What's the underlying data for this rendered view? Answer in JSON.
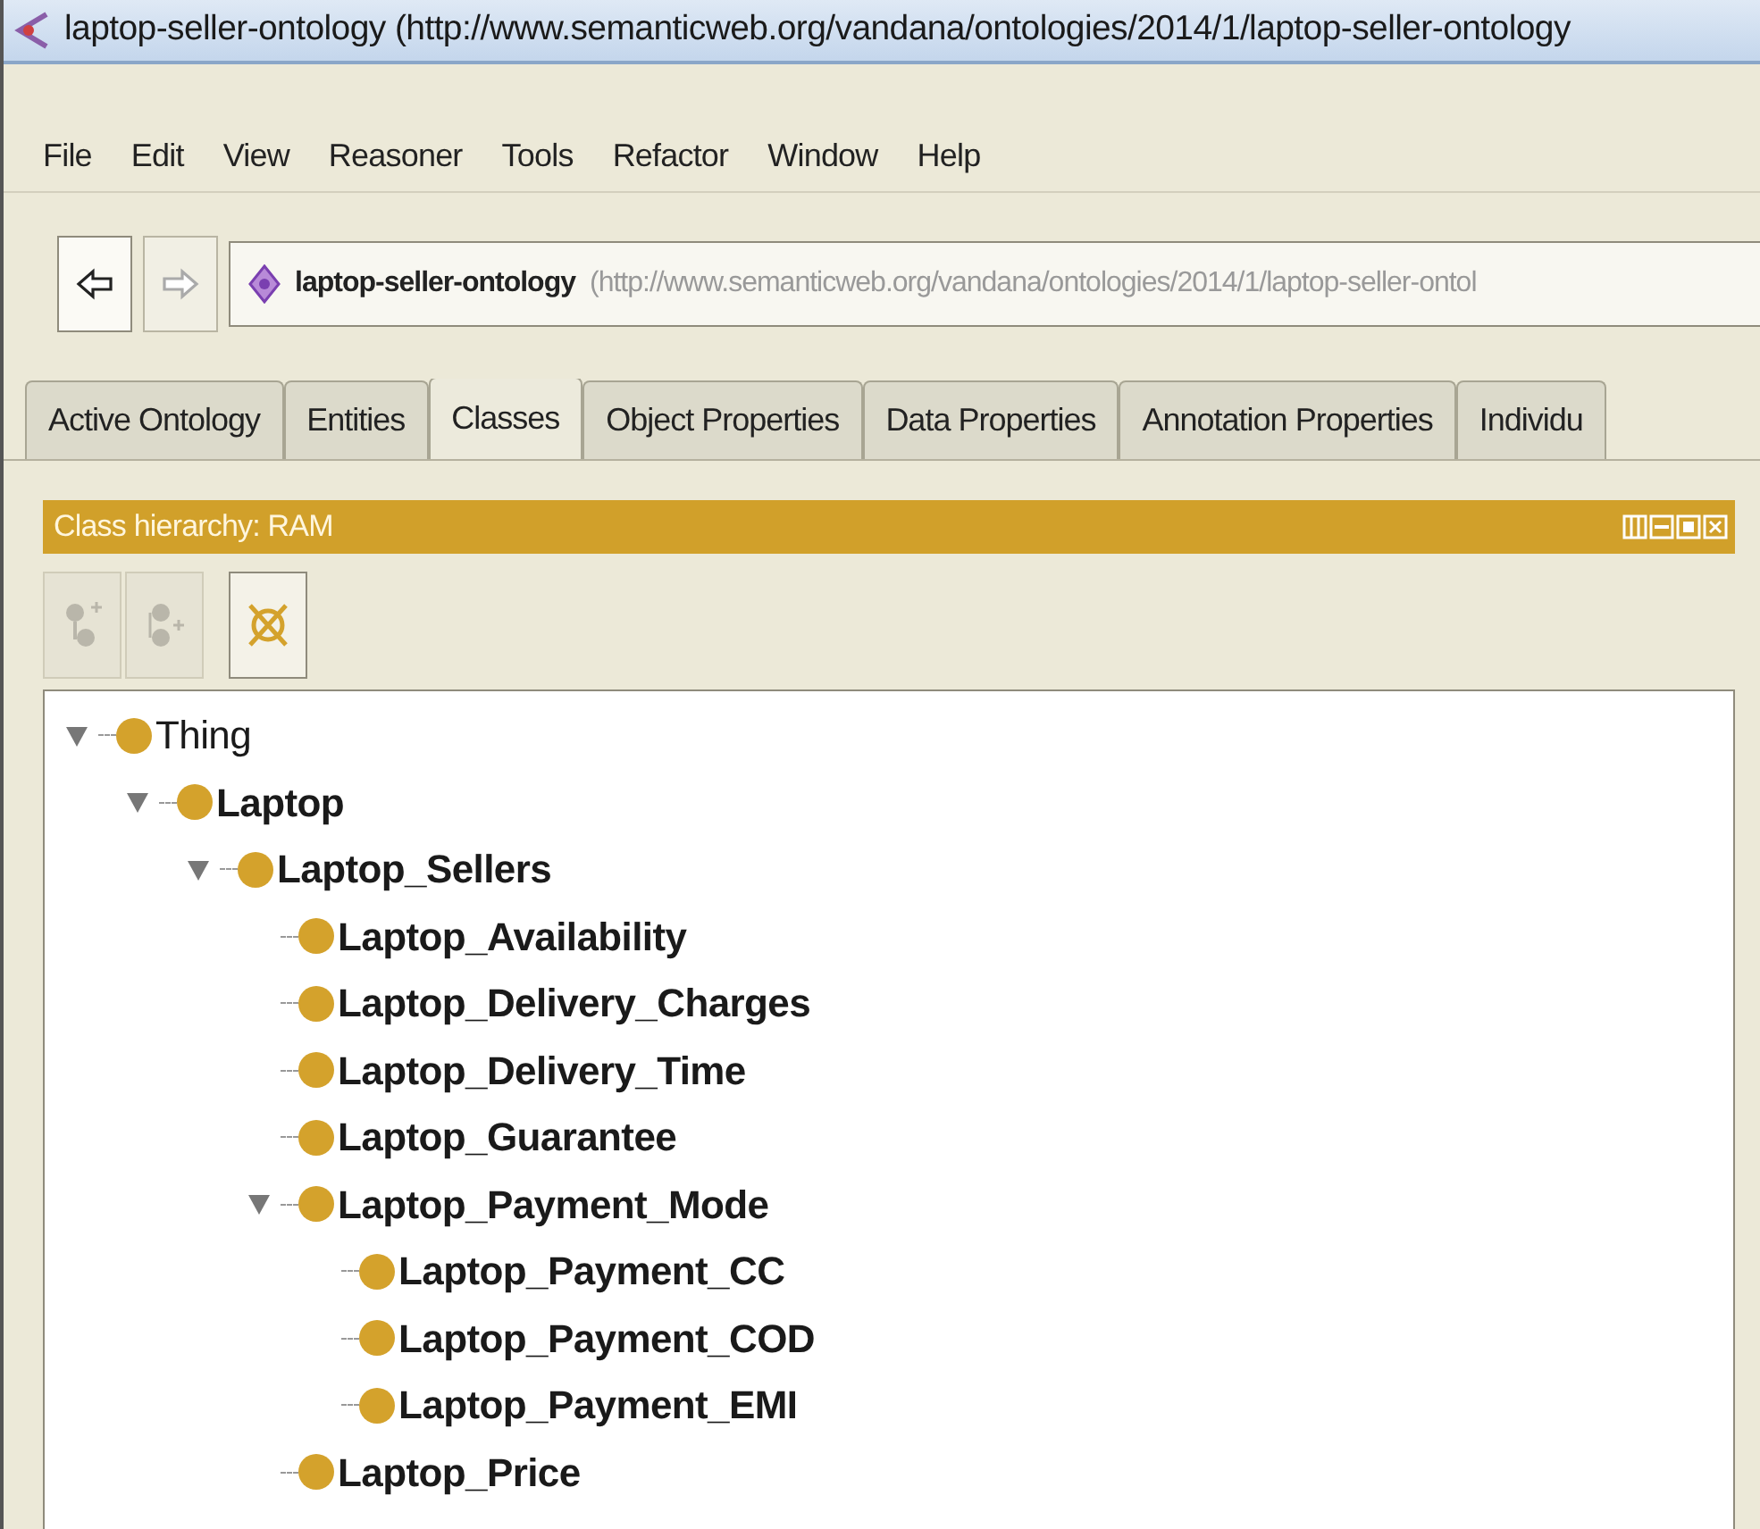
{
  "window": {
    "title": "laptop-seller-ontology (http://www.semanticweb.org/vandana/ontologies/2014/1/laptop-seller-ontology"
  },
  "menu": [
    "File",
    "Edit",
    "View",
    "Reasoner",
    "Tools",
    "Refactor",
    "Window",
    "Help"
  ],
  "nav": {
    "back_disabled": false,
    "forward_disabled": true,
    "ontology_name": "laptop-seller-ontology",
    "ontology_iri": "(http://www.semanticweb.org/vandana/ontologies/2014/1/laptop-seller-ontol"
  },
  "tabs": [
    {
      "label": "Active Ontology",
      "selected": false
    },
    {
      "label": "Entities",
      "selected": false
    },
    {
      "label": "Classes",
      "selected": true
    },
    {
      "label": "Object Properties",
      "selected": false
    },
    {
      "label": "Data Properties",
      "selected": false
    },
    {
      "label": "Annotation Properties",
      "selected": false
    },
    {
      "label": "Individu",
      "selected": false
    }
  ],
  "panel": {
    "title": "Class hierarchy: RAM",
    "toolbar": [
      {
        "kind": "add-subclass",
        "disabled": true
      },
      {
        "kind": "add-sibling",
        "disabled": true
      },
      {
        "kind": "delete",
        "disabled": false
      }
    ],
    "tree": [
      {
        "label": "Thing",
        "bold": false,
        "expanded": true,
        "children": [
          {
            "label": "Laptop",
            "bold": true,
            "expanded": true,
            "children": [
              {
                "label": "Laptop_Sellers",
                "bold": true,
                "expanded": true,
                "children": [
                  {
                    "label": "Laptop_Availability",
                    "bold": true
                  },
                  {
                    "label": "Laptop_Delivery_Charges",
                    "bold": true
                  },
                  {
                    "label": "Laptop_Delivery_Time",
                    "bold": true
                  },
                  {
                    "label": "Laptop_Guarantee",
                    "bold": true
                  },
                  {
                    "label": "Laptop_Payment_Mode",
                    "bold": true,
                    "expanded": true,
                    "children": [
                      {
                        "label": "Laptop_Payment_CC",
                        "bold": true
                      },
                      {
                        "label": "Laptop_Payment_COD",
                        "bold": true
                      },
                      {
                        "label": "Laptop_Payment_EMI",
                        "bold": true
                      }
                    ]
                  },
                  {
                    "label": "Laptop_Price",
                    "bold": true
                  }
                ]
              }
            ]
          }
        ]
      }
    ]
  }
}
